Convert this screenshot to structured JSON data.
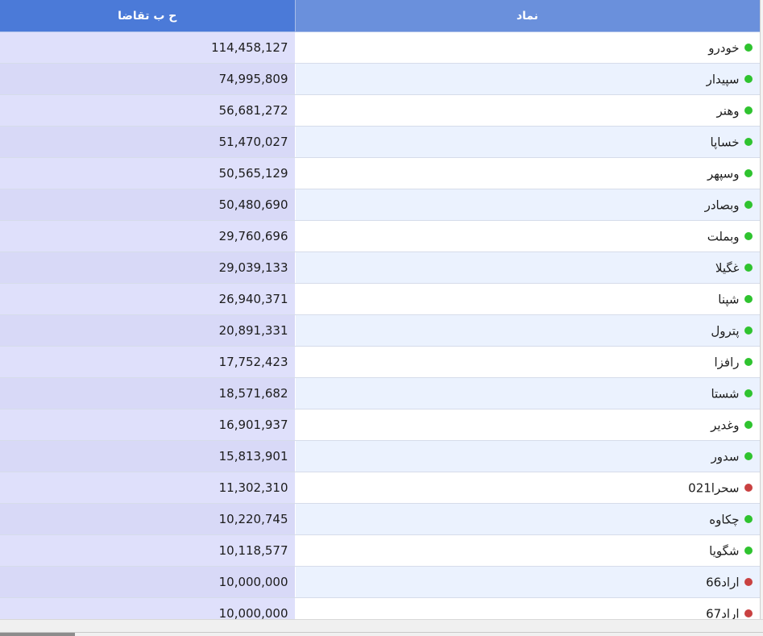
{
  "table": {
    "columns": {
      "demand": "ح ب تقاضا",
      "symbol": "نماد"
    },
    "rows": [
      {
        "symbol": "خودرو",
        "demand": "114,458,127",
        "status": "up"
      },
      {
        "symbol": "سپیدار",
        "demand": "74,995,809",
        "status": "up"
      },
      {
        "symbol": "وهنر",
        "demand": "56,681,272",
        "status": "up"
      },
      {
        "symbol": "خساپا",
        "demand": "51,470,027",
        "status": "up"
      },
      {
        "symbol": "وسپهر",
        "demand": "50,565,129",
        "status": "up"
      },
      {
        "symbol": "وبصادر",
        "demand": "50,480,690",
        "status": "up"
      },
      {
        "symbol": "وبملت",
        "demand": "29,760,696",
        "status": "up"
      },
      {
        "symbol": "غگیلا",
        "demand": "29,039,133",
        "status": "up"
      },
      {
        "symbol": "شپنا",
        "demand": "26,940,371",
        "status": "up"
      },
      {
        "symbol": "پترول",
        "demand": "20,891,331",
        "status": "up"
      },
      {
        "symbol": "رافزا",
        "demand": "17,752,423",
        "status": "up"
      },
      {
        "symbol": "شستا",
        "demand": "18,571,682",
        "status": "up"
      },
      {
        "symbol": "وغدیر",
        "demand": "16,901,937",
        "status": "up"
      },
      {
        "symbol": "سدور",
        "demand": "15,813,901",
        "status": "up"
      },
      {
        "symbol": "سحرا021",
        "demand": "11,302,310",
        "status": "down"
      },
      {
        "symbol": "چکاوه",
        "demand": "10,220,745",
        "status": "up"
      },
      {
        "symbol": "شگویا",
        "demand": "10,118,577",
        "status": "up"
      },
      {
        "symbol": "اراد66",
        "demand": "10,000,000",
        "status": "down"
      },
      {
        "symbol": "اراد67",
        "demand": "10,000,000",
        "status": "down"
      }
    ]
  },
  "colors": {
    "up": "#2fc32f",
    "down": "#c94141",
    "header_demand": "#4b7ad8",
    "header_symbol": "#6a90dc"
  },
  "icons": {
    "up": "status-dot-green-icon",
    "down": "status-dot-red-icon"
  }
}
